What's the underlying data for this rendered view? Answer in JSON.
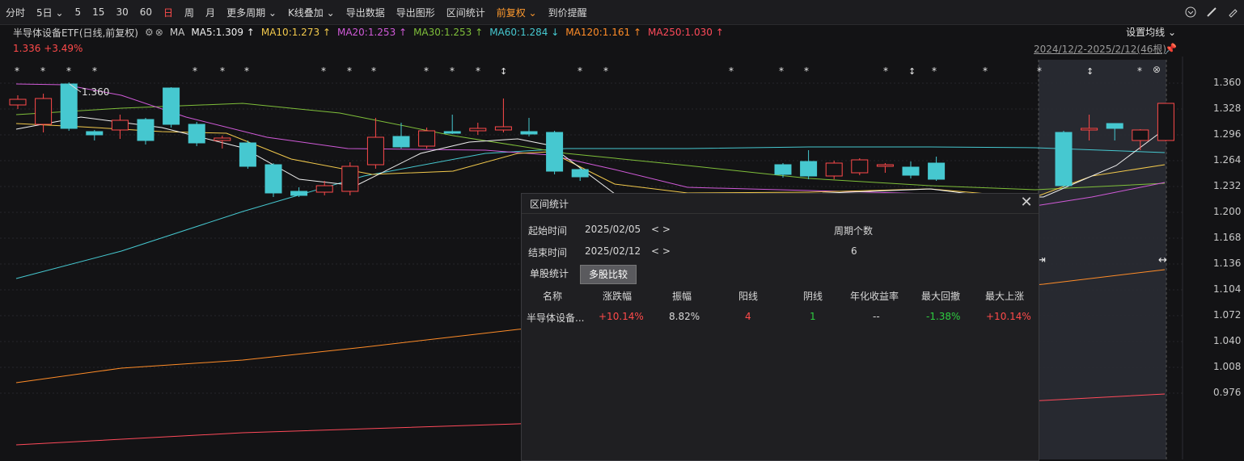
{
  "toolbar": {
    "items": [
      "分时",
      "5日",
      "5",
      "15",
      "30",
      "60",
      "日",
      "周",
      "月",
      "更多周期",
      "K线叠加",
      "导出数据",
      "导出图形",
      "区间统计",
      "前复权",
      "到价提醒"
    ],
    "active_index": 6,
    "orange_index": 14,
    "dropdown_indices": [
      1,
      9,
      10,
      14
    ]
  },
  "legend": {
    "title": "半导体设备ETF(日线,前复权)",
    "ma_label": "MA",
    "ma": [
      {
        "label": "MA5:1.309 ↑",
        "color": "#f0f0f0"
      },
      {
        "label": "MA10:1.273 ↑",
        "color": "#f2c94c"
      },
      {
        "label": "MA20:1.253 ↑",
        "color": "#d05ad8"
      },
      {
        "label": "MA30:1.253 ↑",
        "color": "#7fbf3a"
      },
      {
        "label": "MA60:1.284 ↓",
        "color": "#46c8d0"
      },
      {
        "label": "MA120:1.161 ↑",
        "color": "#ff8c28"
      },
      {
        "label": "MA250:1.030 ↑",
        "color": "#ff4a5a"
      }
    ],
    "price": "1.336",
    "change": "+3.49%",
    "settings": "设置均线",
    "range": "2024/12/2-2025/2/12(46根)"
  },
  "y_axis": {
    "ticks": [
      "1.360",
      "1.328",
      "1.296",
      "1.264",
      "1.232",
      "1.200",
      "1.168",
      "1.136",
      "1.104",
      "1.072",
      "1.040",
      "1.008",
      "0.976"
    ]
  },
  "chart_data": {
    "type": "candlestick",
    "ylim": [
      0.968,
      1.376
    ],
    "max_label": "1.360",
    "candles_left": [
      [
        1.334,
        1.341,
        1.329,
        1.346
      ],
      [
        1.31,
        1.342,
        1.3,
        1.348
      ],
      [
        1.36,
        1.305,
        1.302,
        1.362
      ],
      [
        1.301,
        1.297,
        1.29,
        1.303
      ],
      [
        1.303,
        1.315,
        1.292,
        1.322
      ],
      [
        1.316,
        1.29,
        1.285,
        1.318
      ],
      [
        1.355,
        1.31,
        1.306,
        1.356
      ],
      [
        1.31,
        1.287,
        1.283,
        1.313
      ],
      [
        1.29,
        1.293,
        1.28,
        1.296
      ],
      [
        1.287,
        1.258,
        1.255,
        1.29
      ],
      [
        1.26,
        1.225,
        1.22,
        1.262
      ],
      [
        1.227,
        1.222,
        1.22,
        1.232
      ],
      [
        1.226,
        1.234,
        1.222,
        1.24
      ],
      [
        1.227,
        1.258,
        1.222,
        1.263
      ],
      [
        1.26,
        1.294,
        1.255,
        1.318
      ],
      [
        1.295,
        1.282,
        1.28,
        1.312
      ],
      [
        1.283,
        1.302,
        1.28,
        1.306
      ],
      [
        1.301,
        1.3,
        1.298,
        1.322
      ],
      [
        1.302,
        1.305,
        1.297,
        1.312
      ],
      [
        1.303,
        1.307,
        1.3,
        1.342
      ],
      [
        1.301,
        1.298,
        1.295,
        1.318
      ],
      [
        1.3,
        1.252,
        1.248,
        1.302
      ],
      [
        1.254,
        1.245,
        1.24,
        1.256
      ]
    ],
    "candles_right": [
      [
        1.26,
        1.248,
        1.244,
        1.262
      ],
      [
        1.264,
        1.246,
        1.242,
        1.278
      ],
      [
        1.246,
        1.262,
        1.242,
        1.265
      ],
      [
        1.25,
        1.266,
        1.247,
        1.268
      ],
      [
        1.258,
        1.26,
        1.25,
        1.262
      ],
      [
        1.257,
        1.247,
        1.243,
        1.264
      ],
      [
        1.262,
        1.242,
        1.24,
        1.27
      ]
    ],
    "candles_recent": [
      [
        1.3,
        1.234,
        1.232,
        1.302
      ],
      [
        1.305,
        1.305,
        1.29,
        1.322
      ],
      [
        1.311,
        1.305,
        1.29,
        1.311
      ],
      [
        1.29,
        1.303,
        1.278,
        1.304
      ],
      [
        1.29,
        1.336,
        1.289,
        1.336
      ]
    ]
  },
  "dialog": {
    "title": "区间统计",
    "start_label": "起始时间",
    "start_value": "2025/02/05",
    "end_label": "结束时间",
    "end_value": "2025/02/12",
    "arrows": "< >",
    "period_label": "周期个数",
    "period_value": "6",
    "tab_single": "单股统计",
    "tab_multi": "多股比较",
    "headers": [
      "名称",
      "涨跌幅",
      "振幅",
      "阳线",
      "阴线",
      "年化收益率",
      "最大回撤",
      "最大上涨"
    ],
    "row": {
      "name": "半导体设备...",
      "change": "+10.14%",
      "amplitude": "8.82%",
      "up": "4",
      "down": "1",
      "annual": "--",
      "drawdown": "-1.38%",
      "max_rise": "+10.14%"
    }
  }
}
